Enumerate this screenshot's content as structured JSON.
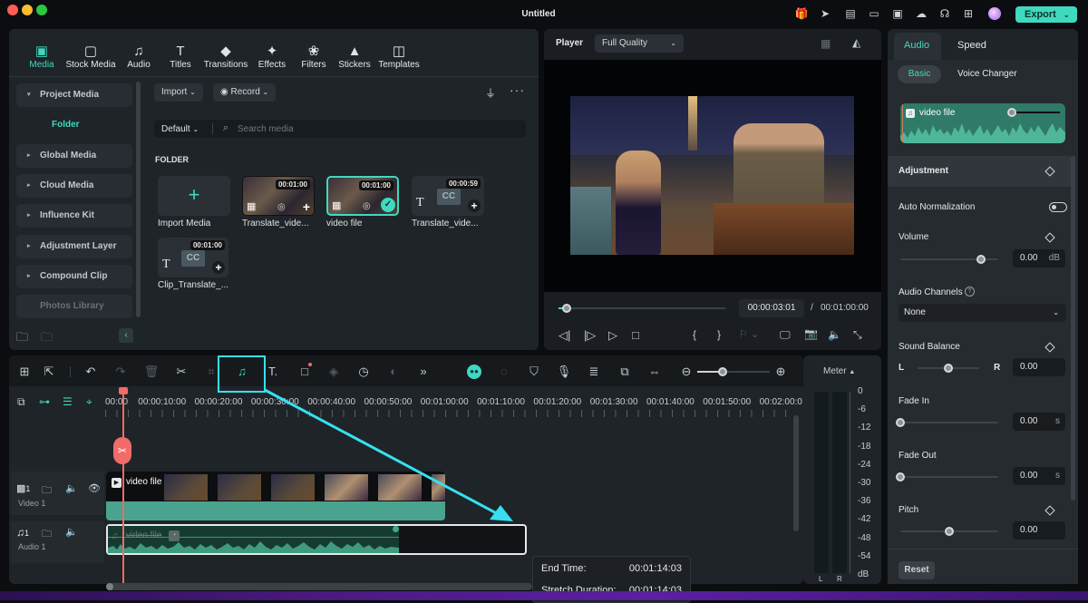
{
  "window": {
    "title": "Untitled",
    "export_label": "Export"
  },
  "top_icons": [
    "gift-icon",
    "send-icon",
    "task-icon",
    "layout-icon",
    "save-icon",
    "cloud-icon",
    "support-icon",
    "apps-icon",
    "avatar"
  ],
  "nav_tabs": [
    {
      "label": "Media",
      "icon": "media-icon",
      "active": true
    },
    {
      "label": "Stock Media",
      "icon": "stock-media-icon"
    },
    {
      "label": "Audio",
      "icon": "audio-icon"
    },
    {
      "label": "Titles",
      "icon": "titles-icon"
    },
    {
      "label": "Transitions",
      "icon": "transitions-icon"
    },
    {
      "label": "Effects",
      "icon": "effects-icon"
    },
    {
      "label": "Filters",
      "icon": "filters-icon"
    },
    {
      "label": "Stickers",
      "icon": "stickers-icon"
    },
    {
      "label": "Templates",
      "icon": "templates-icon"
    }
  ],
  "sidebar": {
    "items": [
      {
        "label": "Project Media",
        "expanded": true
      },
      {
        "label": "Folder",
        "sub": true
      },
      {
        "label": "Global Media"
      },
      {
        "label": "Cloud Media"
      },
      {
        "label": "Influence Kit"
      },
      {
        "label": "Adjustment Layer"
      },
      {
        "label": "Compound Clip"
      },
      {
        "label": "Photos Library"
      }
    ]
  },
  "media": {
    "import_label": "Import",
    "record_label": "Record",
    "sort_label": "Default",
    "search_placeholder": "Search media",
    "folder_heading": "FOLDER",
    "items": [
      {
        "label": "Import Media",
        "type": "import"
      },
      {
        "label": "Translate_vide...",
        "duration": "00:01:00",
        "type": "video"
      },
      {
        "label": "video file",
        "duration": "00:01:00",
        "type": "video",
        "selected": true
      },
      {
        "label": "Translate_vide...",
        "duration": "00:00:59",
        "type": "caption"
      },
      {
        "label": "Clip_Translate_...",
        "duration": "00:01:00",
        "type": "caption"
      }
    ]
  },
  "player": {
    "label": "Player",
    "quality": "Full Quality",
    "current_time": "00:00:03:01",
    "separator": "/",
    "total_time": "00:01:00:00",
    "progress": 0.05
  },
  "right_panel": {
    "tabs": [
      "Audio",
      "Speed"
    ],
    "subtabs": [
      "Basic",
      "Voice Changer"
    ],
    "clip_name": "video file",
    "adjustment_heading": "Adjustment",
    "auto_normalization_label": "Auto Normalization",
    "auto_normalization_on": false,
    "volume": {
      "label": "Volume",
      "value": "0.00",
      "unit": "dB",
      "fraction": 0.82
    },
    "audio_channels": {
      "label": "Audio Channels",
      "value": "None"
    },
    "sound_balance": {
      "label": "Sound Balance",
      "left": "L",
      "right": "R",
      "value": "0.00",
      "fraction": 0.5
    },
    "fade_in": {
      "label": "Fade In",
      "value": "0.00",
      "unit": "s",
      "fraction": 0
    },
    "fade_out": {
      "label": "Fade Out",
      "value": "0.00",
      "unit": "s",
      "fraction": 0
    },
    "pitch": {
      "label": "Pitch",
      "value": "0.00",
      "fraction": 0.5
    },
    "reset_label": "Reset"
  },
  "timeline": {
    "ruler": [
      "00:00",
      "00:00:10:00",
      "00:00:20:00",
      "00:00:30:00",
      "00:00:40:00",
      "00:00:50:00",
      "00:01:00:00",
      "00:01:10:00",
      "00:01:20:00",
      "00:01:30:00",
      "00:01:40:00",
      "00:01:50:00",
      "00:02:00:0"
    ],
    "tracks": [
      {
        "name": "Video 1",
        "num": "1",
        "clip": "video file"
      },
      {
        "name": "Audio 1",
        "num": "1",
        "clip": "video file"
      }
    ],
    "zoom_fraction": 0.35,
    "tooltip": {
      "end_time_label": "End Time:",
      "end_time": "00:01:14:03",
      "stretch_label": "Stretch Duration:",
      "stretch": "00:01:14:03"
    }
  },
  "meter": {
    "label": "Meter",
    "scale": [
      "0",
      "-6",
      "-12",
      "-18",
      "-24",
      "-30",
      "-36",
      "-42",
      "-48",
      "-54",
      "dB"
    ],
    "channels": [
      "L",
      "R"
    ]
  },
  "colors": {
    "accent": "#3fd9bf",
    "playhead": "#f26b6b",
    "highlight": "#36e0f0"
  }
}
